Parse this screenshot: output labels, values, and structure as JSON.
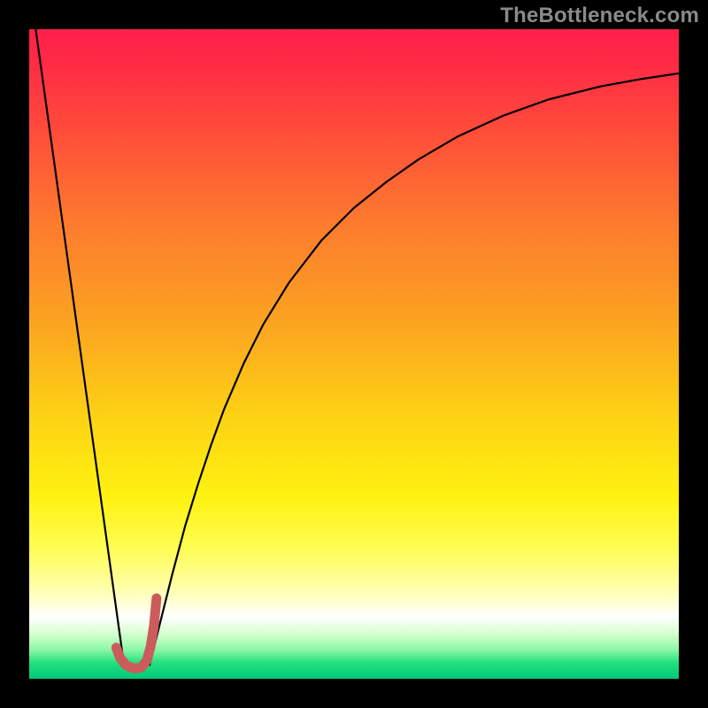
{
  "watermark": "TheBottleneck.com",
  "chart_data": {
    "type": "line",
    "title": "",
    "xlabel": "",
    "ylabel": "",
    "xlim": [
      0,
      100
    ],
    "ylim": [
      0,
      100
    ],
    "grid": false,
    "legend": false,
    "gradient_stops": [
      {
        "offset": 0.0,
        "color": "#ff1f4b"
      },
      {
        "offset": 0.05,
        "color": "#ff2a46"
      },
      {
        "offset": 0.15,
        "color": "#ff4a3a"
      },
      {
        "offset": 0.3,
        "color": "#fd7b2e"
      },
      {
        "offset": 0.45,
        "color": "#fca321"
      },
      {
        "offset": 0.6,
        "color": "#fdd314"
      },
      {
        "offset": 0.72,
        "color": "#fef210"
      },
      {
        "offset": 0.8,
        "color": "#fffd55"
      },
      {
        "offset": 0.86,
        "color": "#ffffaa"
      },
      {
        "offset": 0.905,
        "color": "#ffffff"
      },
      {
        "offset": 0.93,
        "color": "#d8ffd0"
      },
      {
        "offset": 0.955,
        "color": "#8cf8a6"
      },
      {
        "offset": 0.975,
        "color": "#25e07d"
      },
      {
        "offset": 1.0,
        "color": "#00c87a"
      }
    ],
    "series": [
      {
        "name": "left-branch",
        "color": "#000000",
        "width": 2.2,
        "x": [
          1.0,
          14.5
        ],
        "y": [
          100.0,
          2.8
        ]
      },
      {
        "name": "right-branch",
        "color": "#000000",
        "width": 2.2,
        "x": [
          18.5,
          20.0,
          22.0,
          24.0,
          26.0,
          28.0,
          30.0,
          33.0,
          36.0,
          40.0,
          45.0,
          50.0,
          55.0,
          60.0,
          66.0,
          73.0,
          80.0,
          88.0,
          94.0,
          100.0
        ],
        "y": [
          2.0,
          8.0,
          16.0,
          23.5,
          30.0,
          36.0,
          41.5,
          48.5,
          54.5,
          61.0,
          67.5,
          72.5,
          76.5,
          80.0,
          83.5,
          86.7,
          89.2,
          91.2,
          92.3,
          93.2
        ]
      },
      {
        "name": "hook",
        "color": "#cc5b5b",
        "width": 11,
        "linecap": "round",
        "x": [
          13.4,
          14.0,
          14.9,
          16.0,
          17.2,
          18.1,
          18.7,
          19.2,
          19.6
        ],
        "y": [
          4.8,
          3.2,
          2.1,
          1.6,
          1.7,
          2.8,
          5.0,
          8.2,
          12.4
        ]
      }
    ]
  }
}
